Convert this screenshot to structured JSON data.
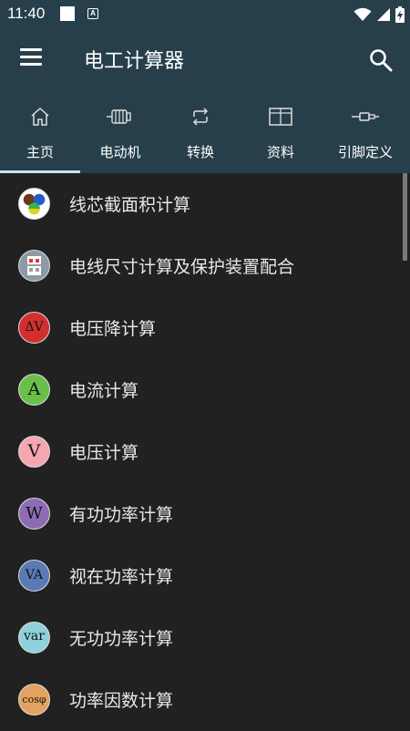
{
  "status_bar": {
    "time": "11:40",
    "notification_icon": "a-box-icon",
    "icons": [
      "wifi-icon",
      "signal-icon",
      "battery-charging-icon"
    ]
  },
  "app_bar": {
    "title": "电工计算器",
    "menu_icon": "hamburger-menu-icon",
    "search_icon": "search-icon"
  },
  "tabs": [
    {
      "label": "主页",
      "icon": "home-icon",
      "selected": true
    },
    {
      "label": "电动机",
      "icon": "motor-icon",
      "selected": false
    },
    {
      "label": "转换",
      "icon": "repeat-icon",
      "selected": false
    },
    {
      "label": "资料",
      "icon": "table-icon",
      "selected": false
    },
    {
      "label": "引脚定义",
      "icon": "plug-icon",
      "selected": false
    }
  ],
  "list": {
    "items": [
      {
        "label": "线芯截面积计算",
        "icon": "wire-cores-icon",
        "glyph": "",
        "color": "#ffffff"
      },
      {
        "label": "电线尺寸计算及保护装置配合",
        "icon": "breaker-icon",
        "glyph": "",
        "color": "#8a9aa6"
      },
      {
        "label": "电压降计算",
        "icon": "voltage-drop-icon",
        "glyph": "ΔV",
        "color": "#d32f2f"
      },
      {
        "label": "电流计算",
        "icon": "current-icon",
        "glyph": "A",
        "color": "#6abf4b"
      },
      {
        "label": "电压计算",
        "icon": "voltage-icon",
        "glyph": "V",
        "color": "#f5a7b0"
      },
      {
        "label": "有功功率计算",
        "icon": "active-power-icon",
        "glyph": "W",
        "color": "#8e6bb5"
      },
      {
        "label": "视在功率计算",
        "icon": "apparent-power-icon",
        "glyph": "VA",
        "color": "#5b79b5"
      },
      {
        "label": "无功功率计算",
        "icon": "reactive-power-icon",
        "glyph": "var",
        "color": "#8fd0db"
      },
      {
        "label": "功率因数计算",
        "icon": "power-factor-icon",
        "glyph": "cosφ",
        "color": "#e3a25f"
      }
    ]
  },
  "colors": {
    "primary": "#263f4b",
    "background": "#212121",
    "tab_indicator": "#bfe4f2",
    "text": "#e8e8e8"
  }
}
